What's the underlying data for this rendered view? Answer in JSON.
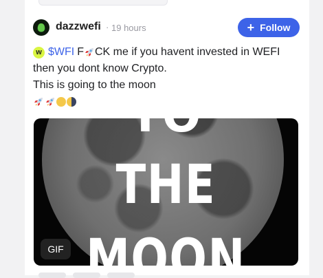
{
  "post": {
    "username": "dazzwefi",
    "separator": "·",
    "time": "19 hours",
    "follow_label": "Follow",
    "follow_icon": "plus-icon",
    "ticker": "$WFI",
    "text_line1_a": "F",
    "text_line1_b": "CK me if you havent invested in WEFI",
    "text_line2": "then you dont know Crypto.",
    "text_line3": "This is going to the moon",
    "emojis": [
      "rocket",
      "rocket",
      "full-moon",
      "first-quarter-moon"
    ]
  },
  "media": {
    "line1": "TO",
    "line2": "THE",
    "line3": "MOON",
    "badge": "GIF"
  },
  "colors": {
    "accent": "#3d63e8",
    "coin": "#d9f542"
  }
}
